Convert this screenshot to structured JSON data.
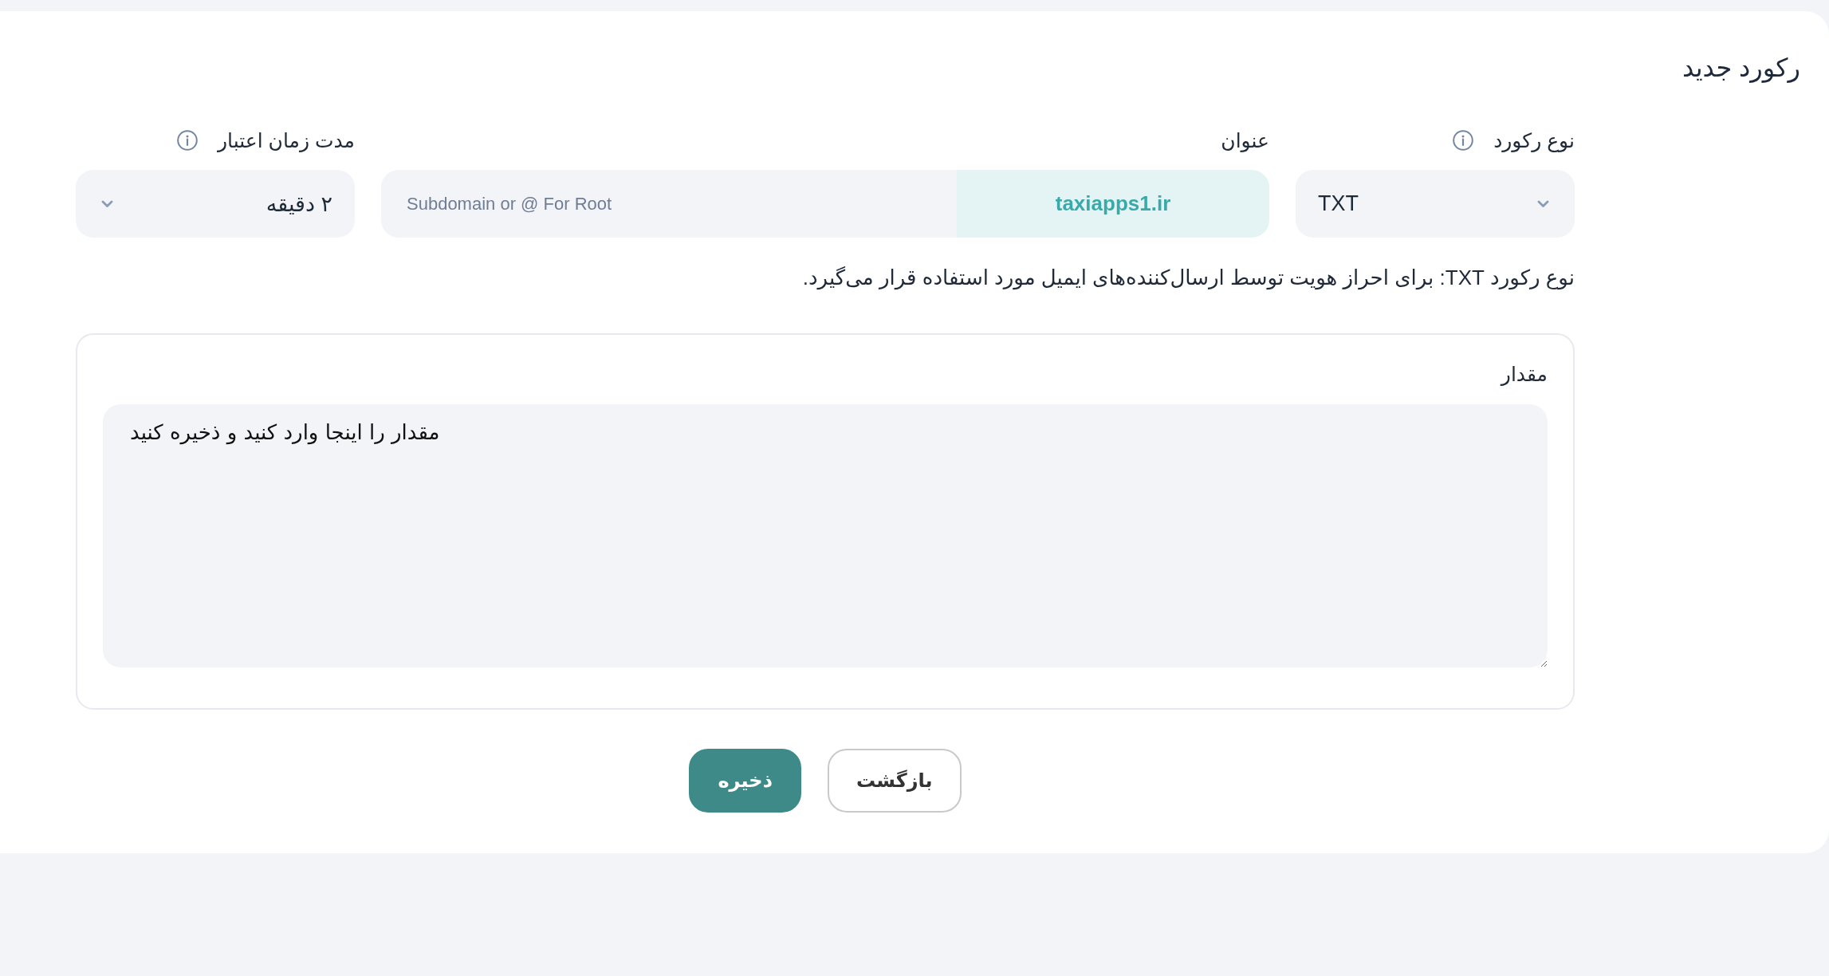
{
  "page": {
    "title": "رکورد جدید"
  },
  "fields": [
    {
      "kind": "select",
      "label": "نوع رکورد",
      "has_info": true,
      "value": "TXT"
    },
    {
      "kind": "domain",
      "label": "عنوان",
      "has_info": false,
      "placeholder": "Subdomain or @ For Root",
      "suffix": "taxiapps1.ir"
    },
    {
      "kind": "select",
      "label": "مدت زمان اعتبار",
      "has_info": true,
      "value": "۲ دقیقه"
    }
  ],
  "description": "نوع رکورد TXT: برای احراز هویت توسط ارسال‌کننده‌های ایمیل مورد استفاده قرار می‌گیرد.",
  "value_section": {
    "label": "مقدار",
    "placeholder": "مقدار را اینجا وارد کنید و ذخیره کنید"
  },
  "buttons": [
    {
      "kind": "secondary",
      "label": "بازگشت"
    },
    {
      "kind": "primary",
      "label": "ذخیره"
    }
  ]
}
